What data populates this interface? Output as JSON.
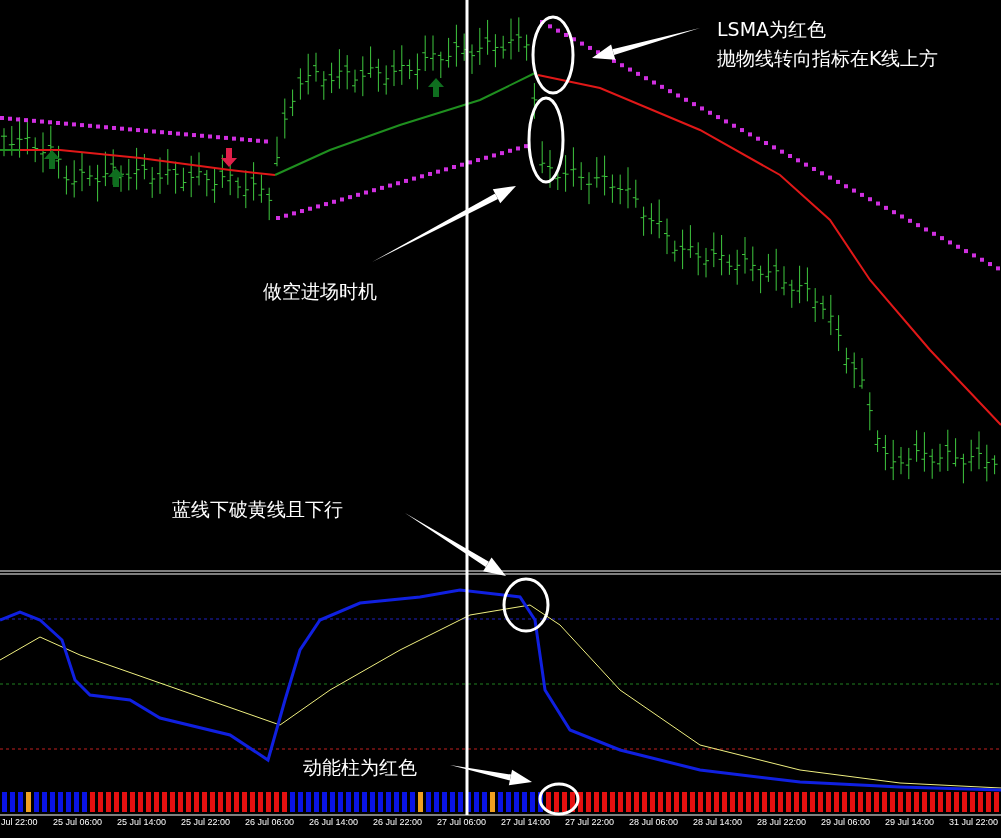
{
  "annotations": [
    {
      "text": "LSMA为红色"
    },
    {
      "text": "抛物线转向指标在K线上方"
    },
    {
      "text": "做空进场时机"
    },
    {
      "text": "蓝线下破黄线且下行"
    },
    {
      "text": "动能柱为红色"
    }
  ],
  "time_axis": {
    "labels": [
      "Jul 22:00",
      "25 Jul 06:00",
      "25 Jul 14:00",
      "25 Jul 22:00",
      "26 Jul 06:00",
      "26 Jul 14:00",
      "26 Jul 22:00",
      "27 Jul 06:00",
      "27 Jul 14:00",
      "27 Jul 22:00",
      "28 Jul 06:00",
      "28 Jul 14:00",
      "28 Jul 22:00",
      "29 Jul 06:00",
      "29 Jul 14:00",
      "31 Jul 22:00"
    ]
  }
}
